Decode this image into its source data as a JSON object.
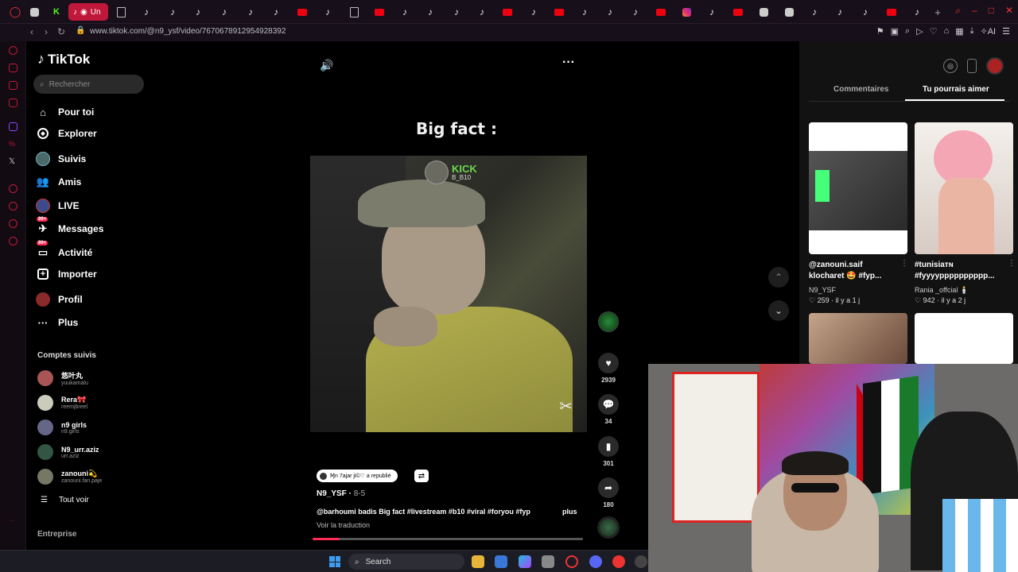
{
  "browser": {
    "active_tab_label": "Un",
    "url": "www.tiktok.com/@n9_ysf/video/7670678912954928392"
  },
  "tiktok_nav": {
    "logo": "TikTok",
    "search_placeholder": "Rechercher",
    "items": [
      {
        "label": "Pour toi",
        "icon": "home-icon"
      },
      {
        "label": "Explorer",
        "icon": "compass-icon"
      },
      {
        "label": "Suivis",
        "icon": "following-avatar-icon"
      },
      {
        "label": "Amis",
        "icon": "friends-icon"
      },
      {
        "label": "LIVE",
        "icon": "live-icon"
      },
      {
        "label": "Messages",
        "icon": "messages-icon",
        "badge": "99+"
      },
      {
        "label": "Activité",
        "icon": "activity-icon",
        "badge": "99+"
      },
      {
        "label": "Importer",
        "icon": "upload-icon"
      },
      {
        "label": "Profil",
        "icon": "profile-icon"
      },
      {
        "label": "Plus",
        "icon": "more-dots-icon"
      }
    ],
    "followed_title": "Comptes suivis",
    "followed": [
      {
        "name": "悠叶丸",
        "handle": "yuukamalu"
      },
      {
        "name": "Rera🎀",
        "handle": "reemjbreel"
      },
      {
        "name": "n9 girls",
        "handle": "n9.girls"
      },
      {
        "name": "N9_urr.aziz",
        "handle": "urr.aziz"
      },
      {
        "name": "zanouni💫",
        "handle": "zanouni.fan.paje"
      }
    ],
    "see_all": "Tout voir",
    "enterprise": "Entreprise"
  },
  "video": {
    "overlay_caption": "Big fact :",
    "stream_platform": "KICK",
    "stream_user": "B_B10",
    "repost_text": "Ɱn 7ajar ji©♡ a republié",
    "author": "N9_YSF",
    "date": "8-5",
    "description": "@barhoumi badis Big fact #livestream #b10 #viral #foryou #fyp",
    "more": "plus",
    "translate": "Voir la traduction",
    "progress_fraction": 0.1
  },
  "actions": {
    "likes": "2939",
    "comments": "34",
    "saves": "301",
    "shares": "180"
  },
  "right_panel": {
    "tab_comments": "Commentaires",
    "tab_like": "Tu pourrais aimer",
    "cards": [
      {
        "title_line1": "@zanouni.saif",
        "title_line2": "klocharet 🤩 #fyp...",
        "user": "N9_YSF",
        "stats": "♡ 259 · il y a 1 j"
      },
      {
        "title_line1": "#tunisiaᴛɴ",
        "title_line2": "#fyyyypppppppppp...",
        "user": "Rania _offcial 🕯️",
        "stats": "♡ 942 · il y a 2 j"
      }
    ]
  },
  "taskbar": {
    "search_label": "Search"
  },
  "colors": {
    "accent": "#fe2c55",
    "opera_red": "#c0183a",
    "kick_green": "#6fd64f"
  }
}
